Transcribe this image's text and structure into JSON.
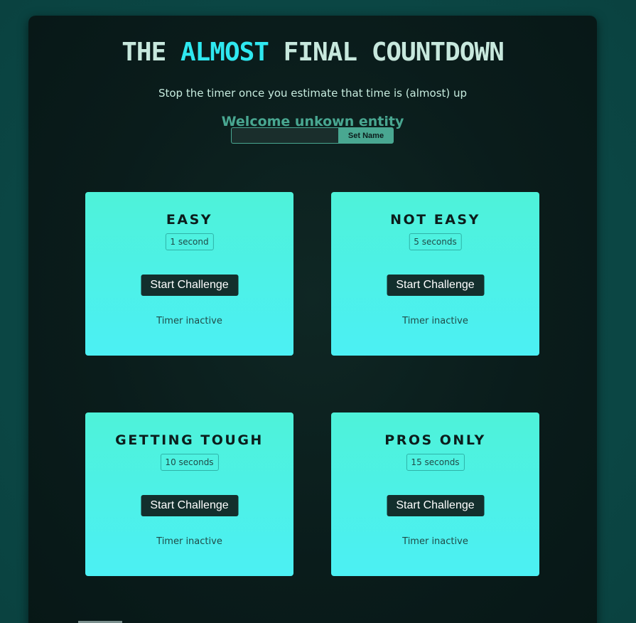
{
  "header": {
    "title_part1": "THE ",
    "title_accent": "ALMOST",
    "title_part2": " FINAL COUNTDOWN",
    "subtitle": "Stop the timer once you estimate that time is (almost) up",
    "welcome": "Welcome unkown entity"
  },
  "name_form": {
    "input_value": "",
    "input_placeholder": "",
    "button_label": "Set Name"
  },
  "challenges": [
    {
      "title": "EASY",
      "duration": "1 second",
      "button_label": "Start Challenge",
      "status": "Timer inactive"
    },
    {
      "title": "NOT EASY",
      "duration": "5 seconds",
      "button_label": "Start Challenge",
      "status": "Timer inactive"
    },
    {
      "title": "GETTING TOUGH",
      "duration": "10 seconds",
      "button_label": "Start Challenge",
      "status": "Timer inactive"
    },
    {
      "title": "PROS ONLY",
      "duration": "15 seconds",
      "button_label": "Start Challenge",
      "status": "Timer inactive"
    }
  ],
  "colors": {
    "background": "#0b4644",
    "panel": "#0a1c1b",
    "accent_cyan": "#2fe8f0",
    "accent_green": "#49a791",
    "card_top": "#4ef2d9",
    "card_bottom": "#4cf0f4",
    "button_dark": "#132f2d"
  }
}
